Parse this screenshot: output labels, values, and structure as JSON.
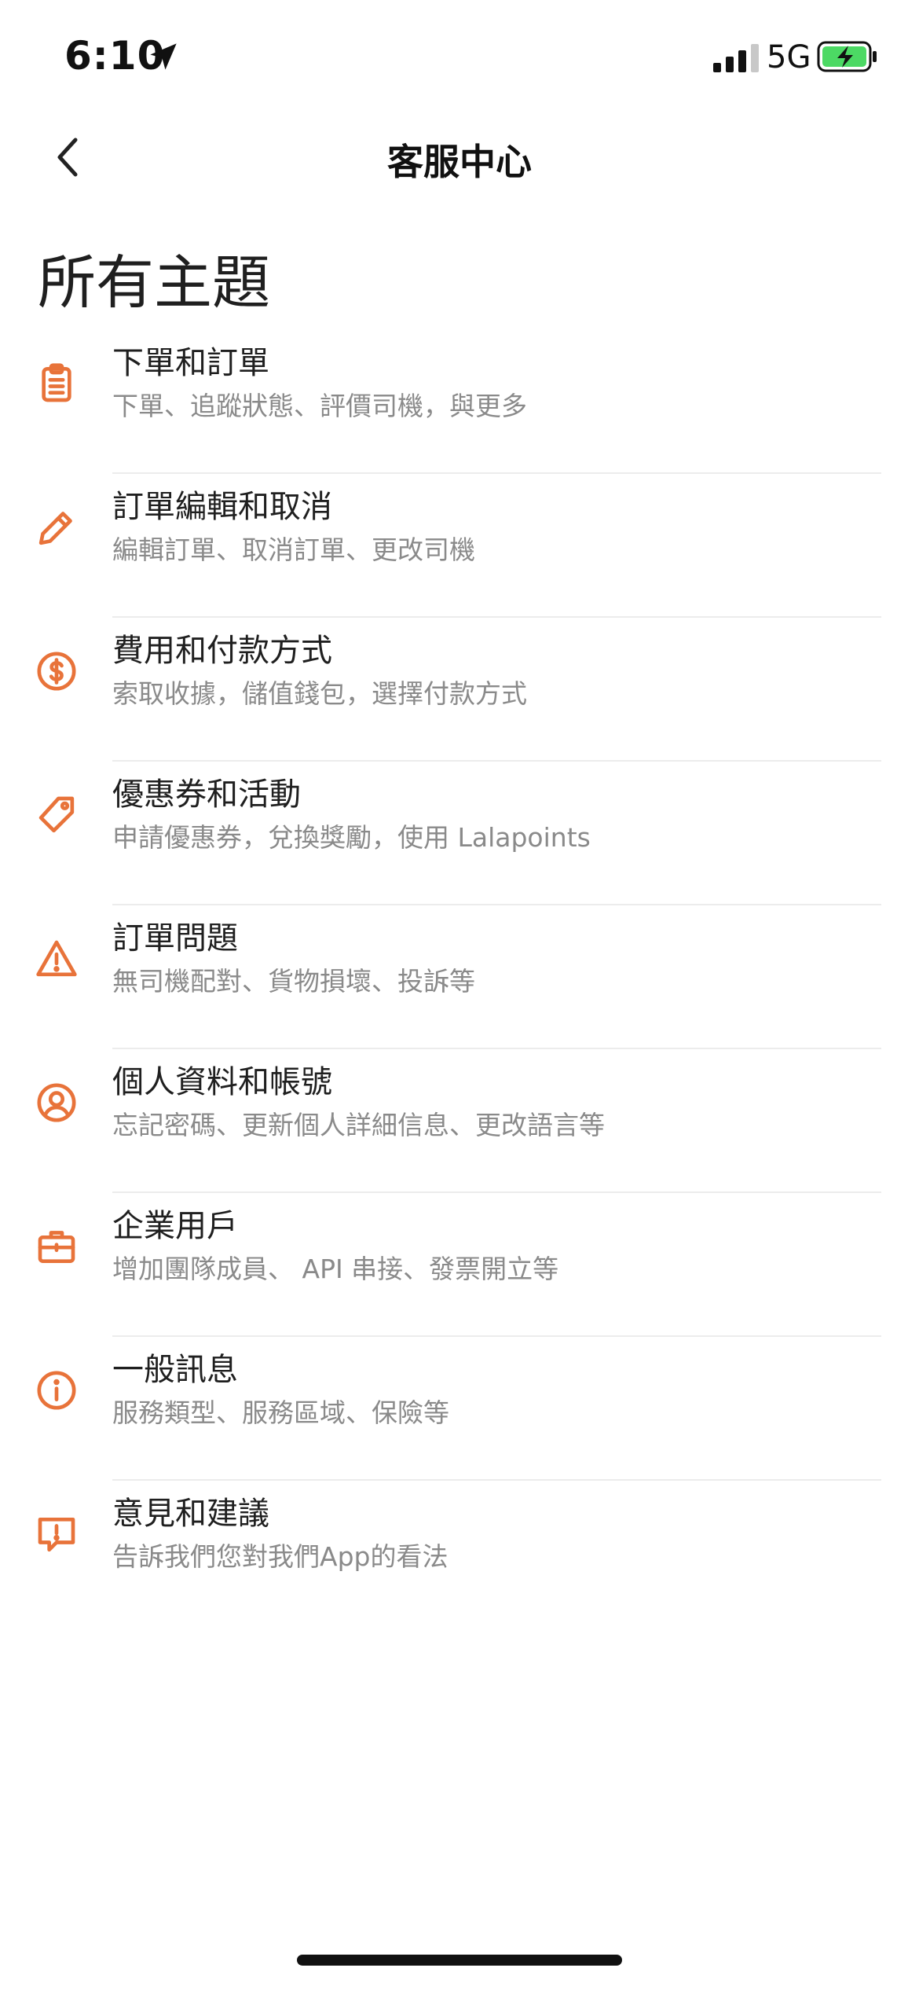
{
  "status_bar": {
    "time": "6:10",
    "network": "5G"
  },
  "nav": {
    "title": "客服中心"
  },
  "section": {
    "title": "所有主題"
  },
  "colors": {
    "accent": "#E8733A",
    "divider": "#ECECEC",
    "subtitle": "#8A8A8A"
  },
  "topics": [
    {
      "icon": "clipboard-icon",
      "title": "下單和訂單",
      "subtitle": "下單、追蹤狀態、評價司機，與更多"
    },
    {
      "icon": "pencil-icon",
      "title": "訂單編輯和取消",
      "subtitle": "編輯訂單、取消訂單、更改司機"
    },
    {
      "icon": "dollar-icon",
      "title": "費用和付款方式",
      "subtitle": "索取收據，儲值錢包，選擇付款方式"
    },
    {
      "icon": "tag-icon",
      "title": "優惠券和活動",
      "subtitle": "申請優惠券，兌換獎勵，使用 Lalapoints"
    },
    {
      "icon": "warning-icon",
      "title": "訂單問題",
      "subtitle": "無司機配對、貨物損壞、投訴等"
    },
    {
      "icon": "user-circle-icon",
      "title": "個人資料和帳號",
      "subtitle": "忘記密碼、更新個人詳細信息、更改語言等"
    },
    {
      "icon": "briefcase-icon",
      "title": "企業用戶",
      "subtitle": "增加團隊成員、 API 串接、發票開立等"
    },
    {
      "icon": "info-icon",
      "title": "一般訊息",
      "subtitle": "服務類型、服務區域、保險等"
    },
    {
      "icon": "feedback-icon",
      "title": "意見和建議",
      "subtitle": "告訴我們您對我們App的看法"
    }
  ]
}
